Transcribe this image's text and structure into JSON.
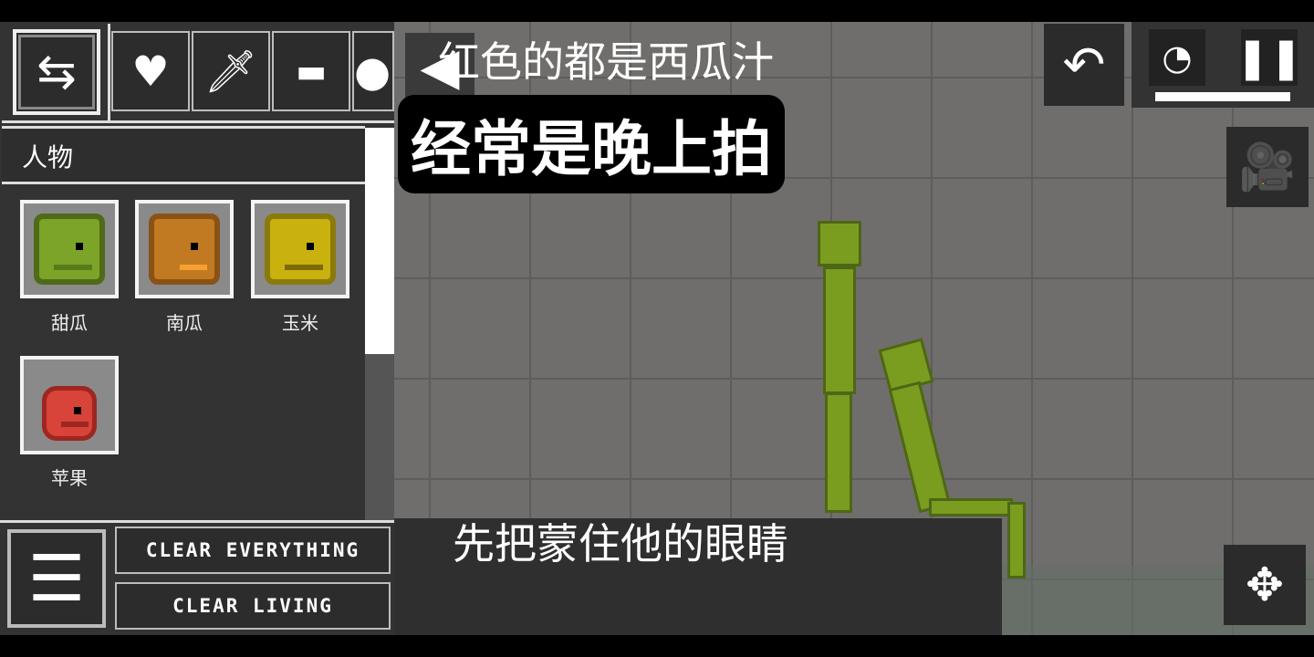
{
  "toolbar": {
    "swap_icon": "swap-arrows-icon",
    "categories": [
      {
        "icon": "heart-icon"
      },
      {
        "icon": "sword-icon"
      },
      {
        "icon": "pistol-icon"
      },
      {
        "icon": "explosive-icon"
      }
    ],
    "collapse_icon": "triangle-left-icon"
  },
  "category_title": "人物",
  "items": [
    {
      "label": "甜瓜",
      "color": "#7ba428"
    },
    {
      "label": "南瓜",
      "color": "#c27a22"
    },
    {
      "label": "玉米",
      "color": "#c9b20e"
    },
    {
      "label": "苹果",
      "color": "#d8433a"
    }
  ],
  "buttons": {
    "clear_everything": "CLEAR EVERYTHING",
    "clear_living": "CLEAR LIVING"
  },
  "controls": {
    "undo_icon": "undo-icon",
    "slowmo_icon": "slow-motion-icon",
    "pause_icon": "pause-icon",
    "camera_icon": "camera-icon",
    "move_icon": "move-arrows-icon"
  },
  "subtitles": {
    "top": "红色的都是西瓜汁",
    "main": "经常是晚上拍",
    "bottom": "先把蒙住他的眼睛"
  }
}
